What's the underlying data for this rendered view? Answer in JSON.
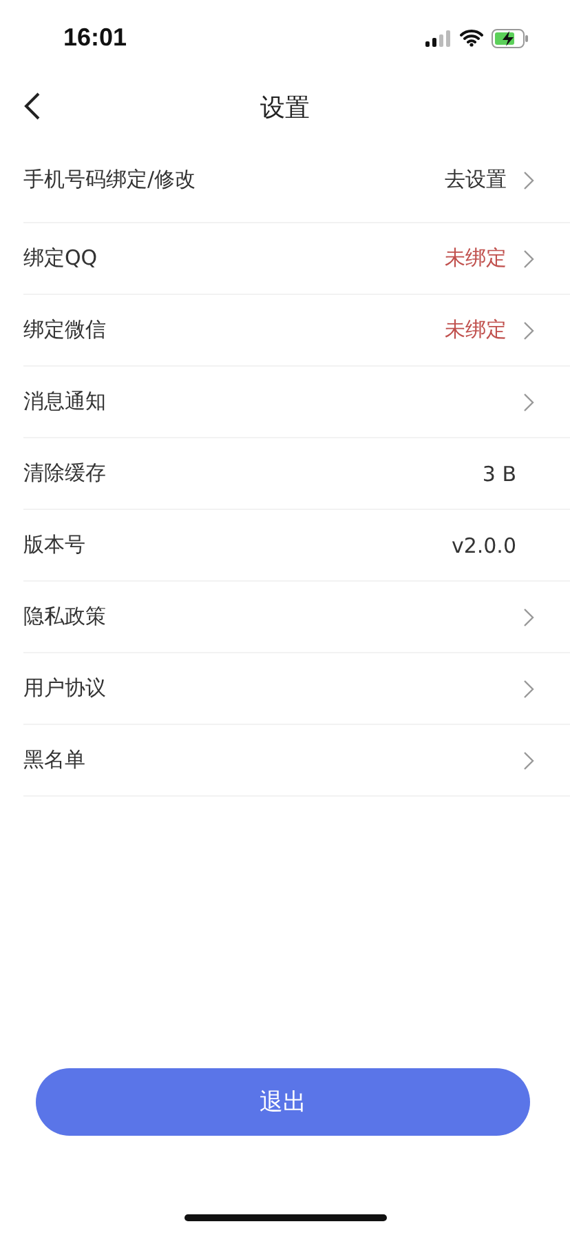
{
  "status_bar": {
    "time": "16:01"
  },
  "header": {
    "title": "设置"
  },
  "rows": [
    {
      "label": "手机号码绑定/修改",
      "value": "去设置",
      "alert": false,
      "chevron": true
    },
    {
      "label": "绑定QQ",
      "value": "未绑定",
      "alert": true,
      "chevron": true
    },
    {
      "label": "绑定微信",
      "value": "未绑定",
      "alert": true,
      "chevron": true
    },
    {
      "label": "消息通知",
      "chevron": true
    },
    {
      "label": "清除缓存",
      "value": "3 B",
      "alert": false,
      "chevron": false
    },
    {
      "label": "版本号",
      "value": "v2.0.0",
      "alert": false,
      "chevron": false
    },
    {
      "label": "隐私政策",
      "chevron": true
    },
    {
      "label": "用户协议",
      "chevron": true
    },
    {
      "label": "黑名单",
      "chevron": true
    }
  ],
  "logout_button": "退出"
}
